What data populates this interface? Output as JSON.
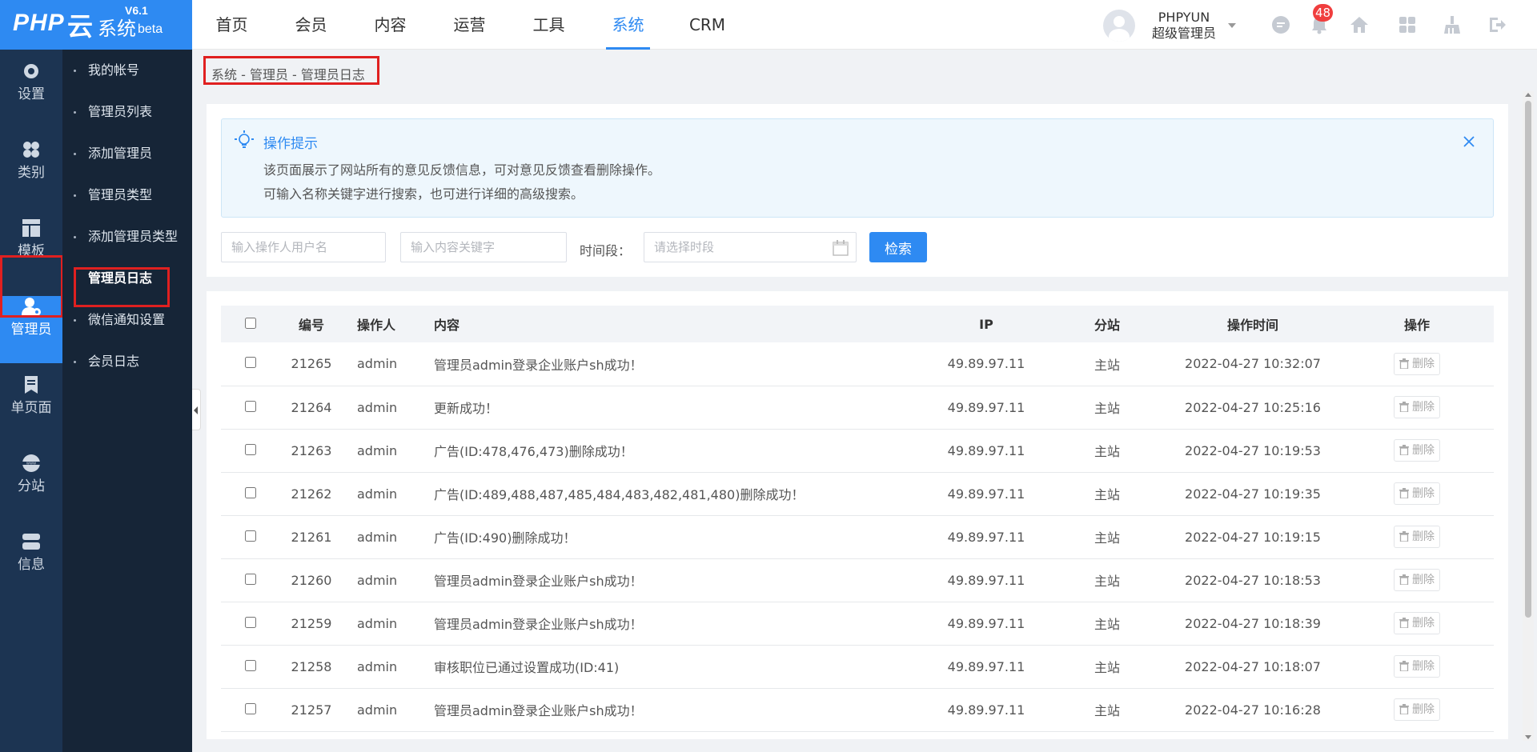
{
  "logo": {
    "php": "PHP",
    "yun": "云",
    "sys": "系统",
    "version": "V6.1",
    "beta": "beta"
  },
  "topnav": [
    {
      "label": "首页",
      "active": false
    },
    {
      "label": "会员",
      "active": false
    },
    {
      "label": "内容",
      "active": false
    },
    {
      "label": "运营",
      "active": false
    },
    {
      "label": "工具",
      "active": false
    },
    {
      "label": "系统",
      "active": true
    },
    {
      "label": "CRM",
      "active": false
    }
  ],
  "user": {
    "name": "PHPYUN",
    "role": "超级管理员"
  },
  "notifications": {
    "count": "48"
  },
  "header_icons": [
    "chat-icon",
    "bell-icon",
    "home-icon",
    "grid-icon",
    "broom-icon",
    "logout-icon"
  ],
  "rail": [
    {
      "label": "设置",
      "icon": "gear-icon"
    },
    {
      "label": "类别",
      "icon": "category-icon"
    },
    {
      "label": "模板",
      "icon": "template-icon"
    },
    {
      "label": "管理员",
      "icon": "admin-icon",
      "active": true
    },
    {
      "label": "单页面",
      "icon": "page-icon"
    },
    {
      "label": "分站",
      "icon": "globe-icon"
    },
    {
      "label": "信息",
      "icon": "info-icon"
    }
  ],
  "submenu": [
    {
      "label": "我的帐号"
    },
    {
      "label": "管理员列表"
    },
    {
      "label": "添加管理员"
    },
    {
      "label": "管理员类型"
    },
    {
      "label": "添加管理员类型"
    },
    {
      "label": "管理员日志",
      "active": true
    },
    {
      "label": "微信通知设置"
    },
    {
      "label": "会员日志"
    }
  ],
  "breadcrumb": "系统 - 管理员 - 管理员日志",
  "tip": {
    "title": "操作提示",
    "line1": "该页面展示了网站所有的意见反馈信息，可对意见反馈查看删除操作。",
    "line2": "可输入名称关键字进行搜索，也可进行详细的高级搜索。"
  },
  "search": {
    "operator_placeholder": "输入操作人用户名",
    "keyword_placeholder": "输入内容关键字",
    "time_label": "时间段：",
    "time_placeholder": "请选择时段",
    "button": "检索"
  },
  "table": {
    "headers": {
      "id": "编号",
      "operator": "操作人",
      "content": "内容",
      "ip": "IP",
      "branch": "分站",
      "time": "操作时间",
      "action": "操作"
    },
    "delete_label": "删除",
    "rows": [
      {
        "id": "21265",
        "operator": "admin",
        "content": "管理员admin登录企业账户sh成功！",
        "ip": "49.89.97.11",
        "branch": "主站",
        "time": "2022-04-27 10:32:07"
      },
      {
        "id": "21264",
        "operator": "admin",
        "content": "更新成功！",
        "ip": "49.89.97.11",
        "branch": "主站",
        "time": "2022-04-27 10:25:16"
      },
      {
        "id": "21263",
        "operator": "admin",
        "content": "广告(ID:478,476,473)删除成功！",
        "ip": "49.89.97.11",
        "branch": "主站",
        "time": "2022-04-27 10:19:53"
      },
      {
        "id": "21262",
        "operator": "admin",
        "content": "广告(ID:489,488,487,485,484,483,482,481,480)删除成功！",
        "ip": "49.89.97.11",
        "branch": "主站",
        "time": "2022-04-27 10:19:35"
      },
      {
        "id": "21261",
        "operator": "admin",
        "content": "广告(ID:490)删除成功！",
        "ip": "49.89.97.11",
        "branch": "主站",
        "time": "2022-04-27 10:19:15"
      },
      {
        "id": "21260",
        "operator": "admin",
        "content": "管理员admin登录企业账户sh成功！",
        "ip": "49.89.97.11",
        "branch": "主站",
        "time": "2022-04-27 10:18:53"
      },
      {
        "id": "21259",
        "operator": "admin",
        "content": "管理员admin登录企业账户sh成功！",
        "ip": "49.89.97.11",
        "branch": "主站",
        "time": "2022-04-27 10:18:39"
      },
      {
        "id": "21258",
        "operator": "admin",
        "content": "审核职位已通过设置成功(ID:41)",
        "ip": "49.89.97.11",
        "branch": "主站",
        "time": "2022-04-27 10:18:07"
      },
      {
        "id": "21257",
        "operator": "admin",
        "content": "管理员admin登录企业账户sh成功！",
        "ip": "49.89.97.11",
        "branch": "主站",
        "time": "2022-04-27 10:16:28"
      }
    ]
  },
  "colors": {
    "accent": "#2e8af2",
    "rail": "#1c3452",
    "submenu": "#162537",
    "highlight": "#e02020",
    "badge": "#f03e3e"
  }
}
